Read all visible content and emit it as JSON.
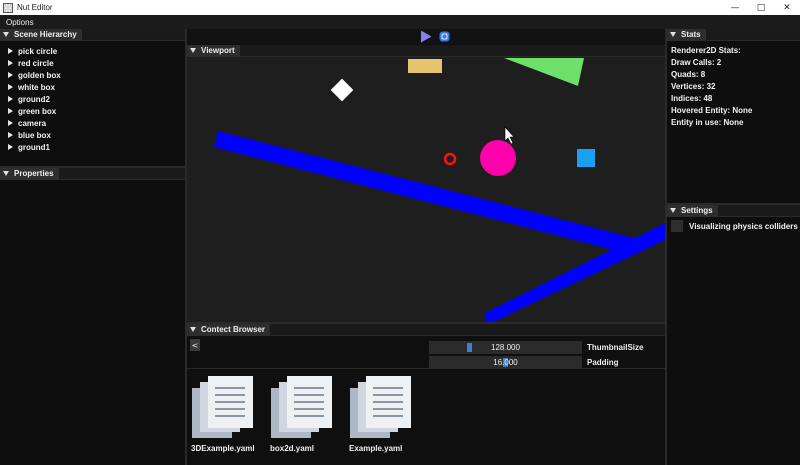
{
  "window": {
    "title": "Nut Editor"
  },
  "menu": {
    "options_label": "Options"
  },
  "hierarchy": {
    "title": "Scene Hierarchy",
    "items": [
      "pick circle",
      "red circle",
      "golden box",
      "white box",
      "ground2",
      "green box",
      "camera",
      "blue box",
      "ground1"
    ]
  },
  "properties": {
    "title": "Properties"
  },
  "stats": {
    "title": "Stats",
    "lines": [
      "Renderer2D Stats:",
      "Draw Calls: 2",
      "Quads: 8",
      "Vertices: 32",
      "Indices: 48",
      "Hovered Entity: None",
      "Entity in use: None"
    ]
  },
  "settings": {
    "title": "Settings",
    "physics_colliders_label": "Visualizing physics colliders",
    "physics_colliders_checked": false
  },
  "viewport": {
    "title": "Viewport"
  },
  "toolbar": {
    "play_icon": "play-icon",
    "simulate_icon": "simulate-icon"
  },
  "content_browser": {
    "title": "Contect Browser",
    "back_label": "<",
    "thumbnail_size": {
      "label": "ThumbnailSize",
      "value": "128.000",
      "fraction": 0.25
    },
    "padding": {
      "label": "Padding",
      "value": "16.000",
      "fraction": 0.5
    },
    "files": [
      "3DExample.yaml",
      "box2d.yaml",
      "Example.yaml"
    ]
  },
  "colors": {
    "accent": "#3f7fd8",
    "blue_ground": "#0000ff",
    "pink_circle": "#ff00aa",
    "red_circle": "#ff1010",
    "golden_box": "#e6c46e",
    "green_box": "#6ee06a",
    "cyan_box": "#1aa0f0"
  }
}
